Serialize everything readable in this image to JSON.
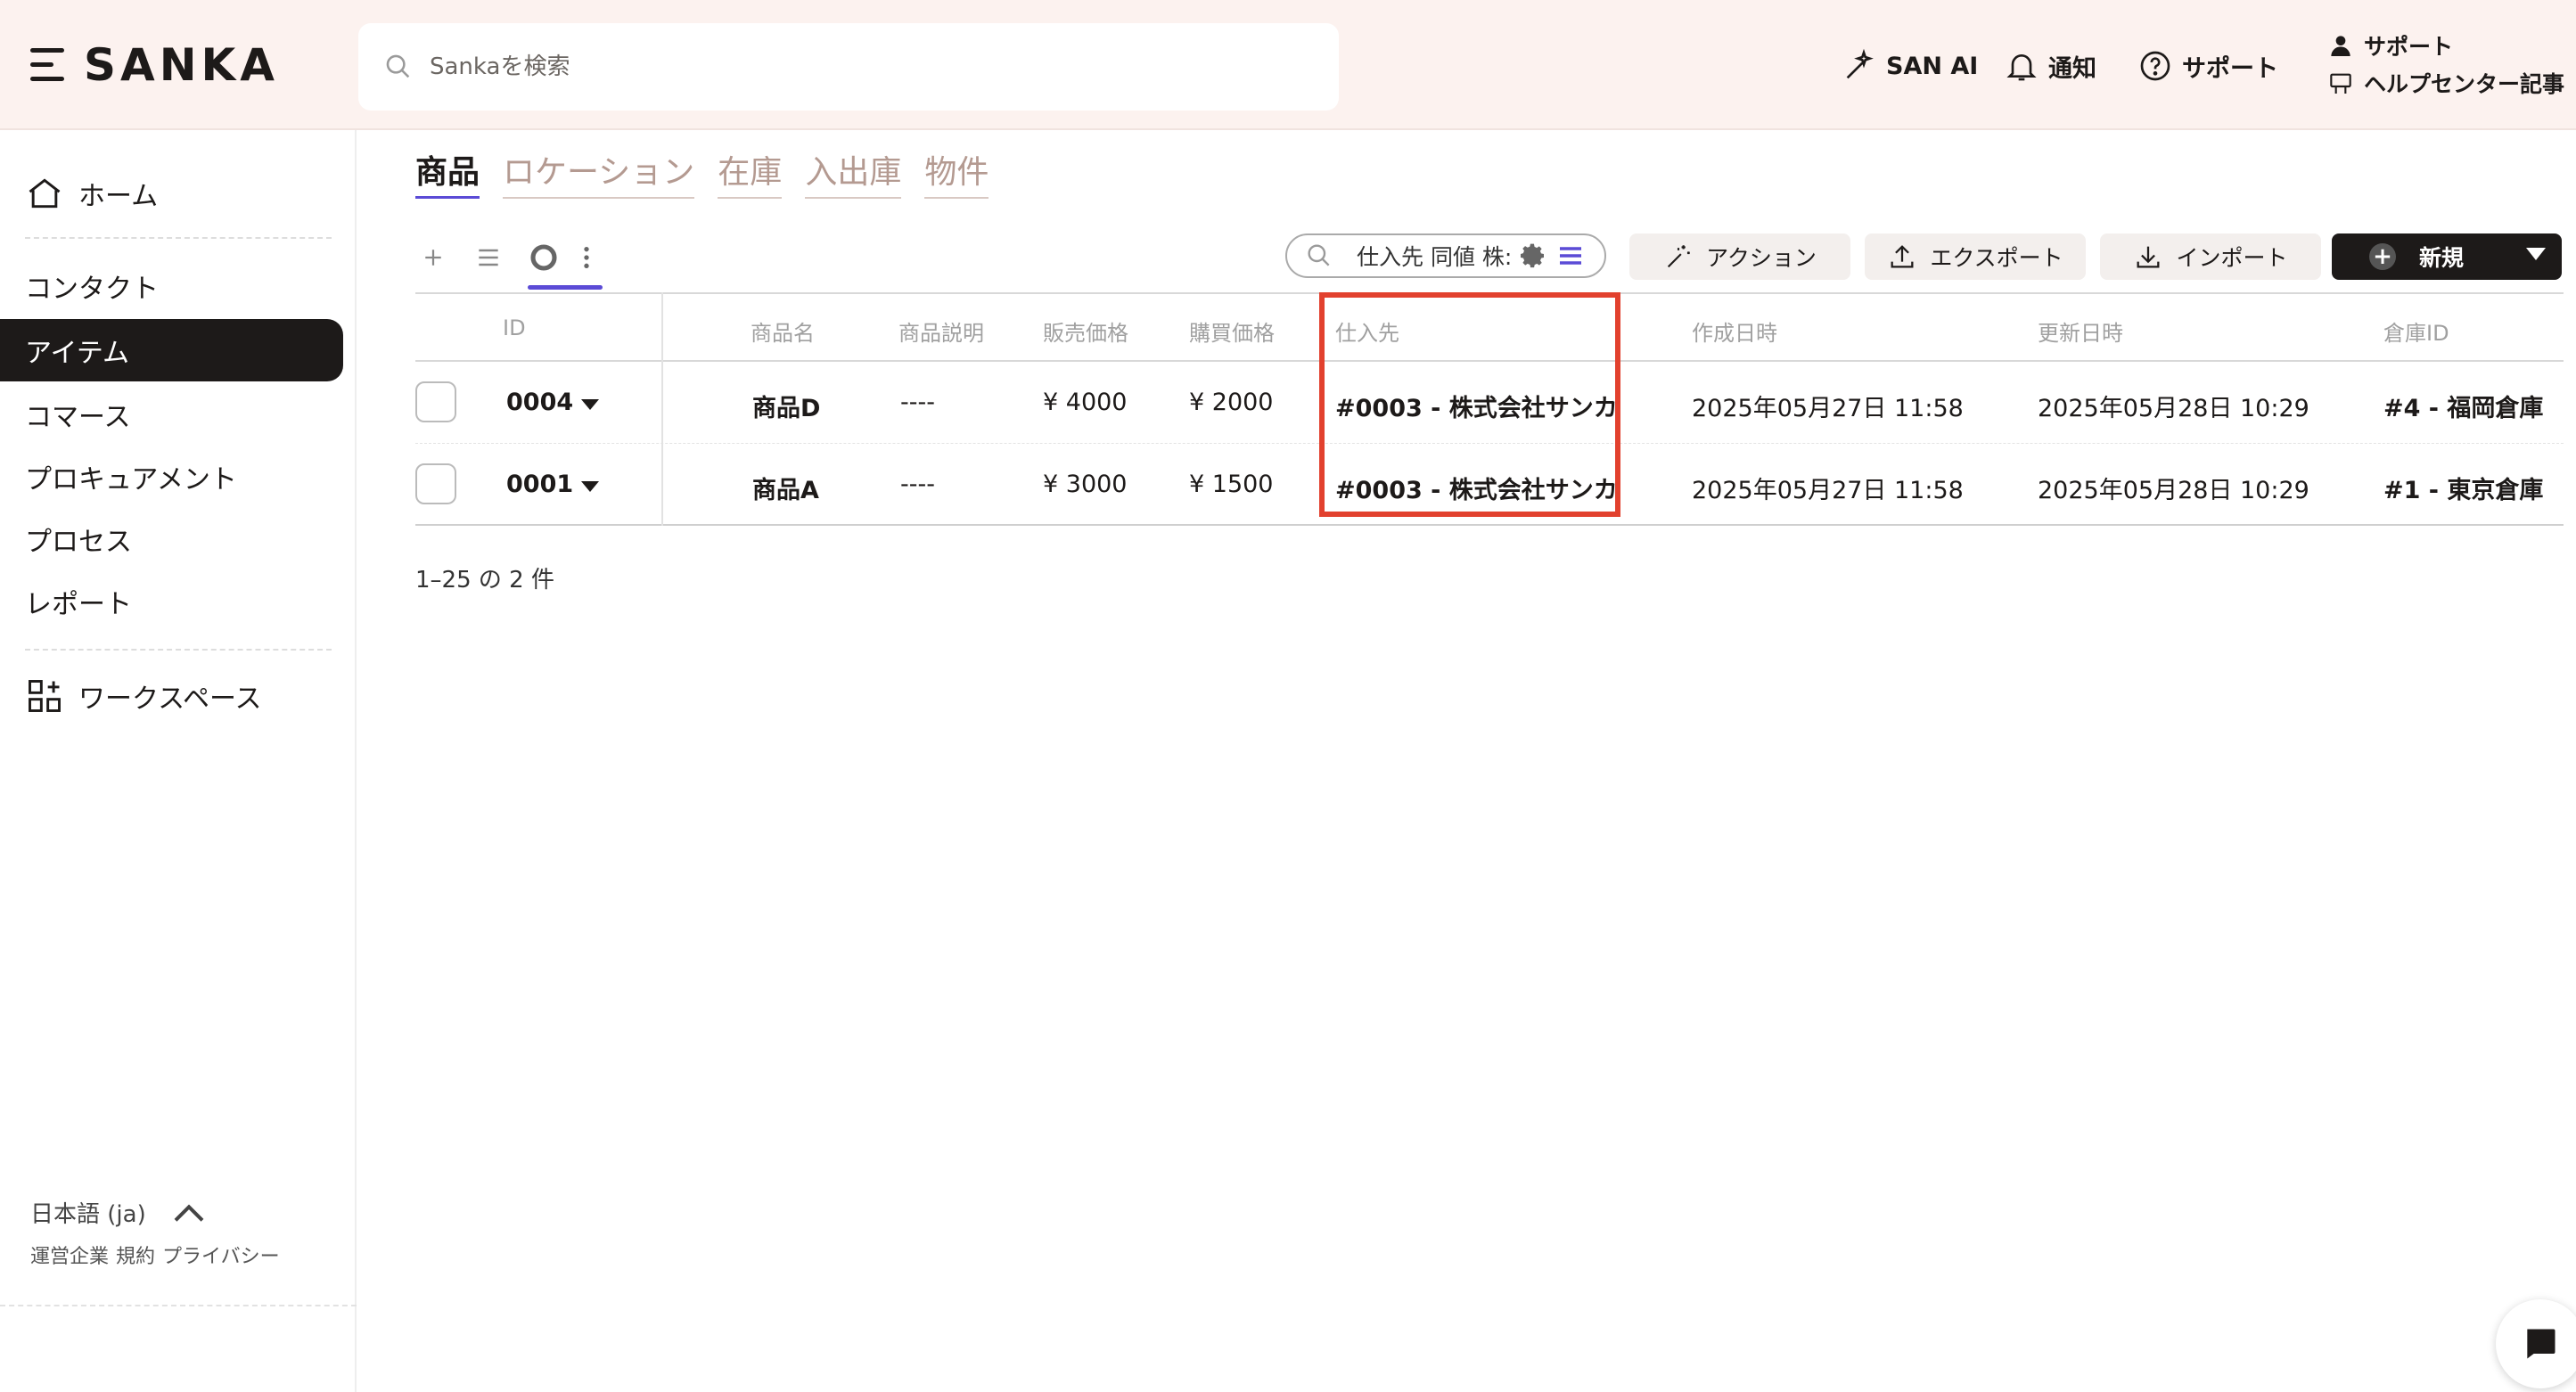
{
  "header": {
    "brand": "SANKA",
    "search_placeholder": "Sankaを検索",
    "nav": {
      "ai": "SAN AI",
      "notifications": "通知",
      "support": "サポート"
    },
    "user": {
      "line1": "サポート",
      "line2": "ヘルプセンター記事"
    }
  },
  "sidebar": {
    "home": "ホーム",
    "items": [
      {
        "label": "コンタクト"
      },
      {
        "label": "アイテム",
        "active": true
      },
      {
        "label": "コマース"
      },
      {
        "label": "プロキュアメント"
      },
      {
        "label": "プロセス"
      },
      {
        "label": "レポート"
      }
    ],
    "workspace": "ワークスペース",
    "language": "日本語 (ja)",
    "footer_links": [
      "運営企業",
      "規約",
      "プライバシー"
    ]
  },
  "tabs": [
    {
      "label": "商品",
      "active": true
    },
    {
      "label": "ロケーション"
    },
    {
      "label": "在庫"
    },
    {
      "label": "入出庫"
    },
    {
      "label": "物件"
    }
  ],
  "toolbar": {
    "filter_text": "仕入先 同値 株:",
    "action": "アクション",
    "export": "エクスポート",
    "import": "インポート",
    "new": "新規"
  },
  "table": {
    "columns": [
      "ID",
      "商品名",
      "商品説明",
      "販売価格",
      "購買価格",
      "仕入先",
      "作成日時",
      "更新日時",
      "倉庫ID"
    ],
    "rows": [
      {
        "id": "0004",
        "name": "商品D",
        "desc": "----",
        "sale": "¥ 4000",
        "purchase": "¥ 2000",
        "supplier": "#0003 - 株式会社サンカ",
        "created": "2025年05月27日 11:58",
        "updated": "2025年05月28日 10:29",
        "warehouse": "#4 - 福岡倉庫"
      },
      {
        "id": "0001",
        "name": "商品A",
        "desc": "----",
        "sale": "¥ 3000",
        "purchase": "¥ 1500",
        "supplier": "#0003 - 株式会社サンカ",
        "created": "2025年05月27日 11:58",
        "updated": "2025年05月28日 10:29",
        "warehouse": "#1 - 東京倉庫"
      }
    ],
    "pagination": "1–25 の 2 件"
  },
  "colors": {
    "accent": "#5b4bd6",
    "highlight": "#e2412e",
    "dark": "#1d1a19",
    "header_bg": "#fcf2ef"
  }
}
